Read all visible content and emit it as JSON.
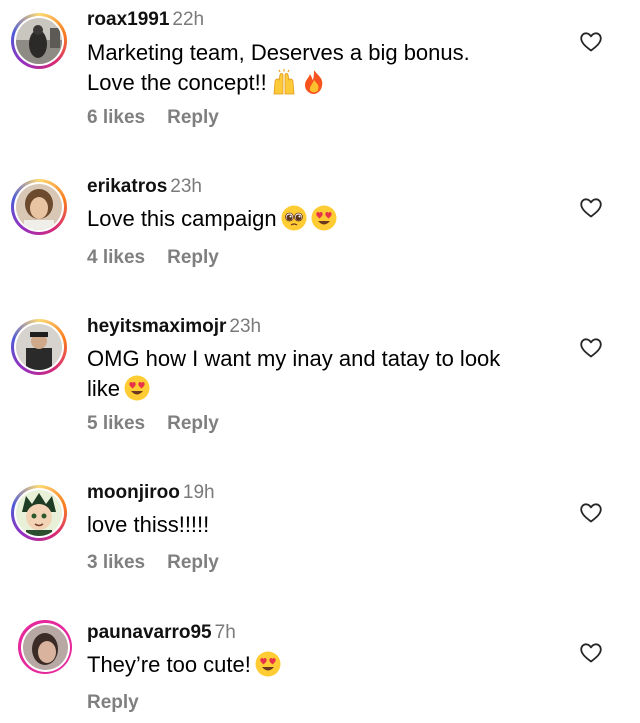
{
  "comments": [
    {
      "username": "roax1991",
      "time": "22h",
      "text": "Marketing team, Deserves a big bonus.",
      "text2": "Love the concept!!",
      "likes": "6 likes",
      "reply": "Reply",
      "emojis": [
        "raising-hands-emoji",
        "fire-emoji"
      ]
    },
    {
      "username": "erikatros",
      "time": "23h",
      "text": "Love this campaign",
      "likes": "4 likes",
      "reply": "Reply",
      "emojis": [
        "pleading-face-emoji",
        "heart-eyes-emoji"
      ]
    },
    {
      "username": "heyitsmaximojr",
      "time": "23h",
      "text": "OMG how I want my inay and tatay to look",
      "text2": "like",
      "likes": "5 likes",
      "reply": "Reply",
      "emojis": [
        "heart-eyes-emoji"
      ]
    },
    {
      "username": "moonjiroo",
      "time": "19h",
      "text": "love thiss!!!!!",
      "likes": "3 likes",
      "reply": "Reply",
      "emojis": []
    },
    {
      "username": "paunavarro95",
      "time": "7h",
      "text": "They’re too cute!",
      "reply": "Reply",
      "emojis": [
        "heart-eyes-emoji"
      ]
    }
  ],
  "icons": {
    "like": "heart-outline-icon"
  },
  "colors": {
    "secondary_text": "#7f7f7f",
    "story_ring_pink": "#e5289b"
  }
}
